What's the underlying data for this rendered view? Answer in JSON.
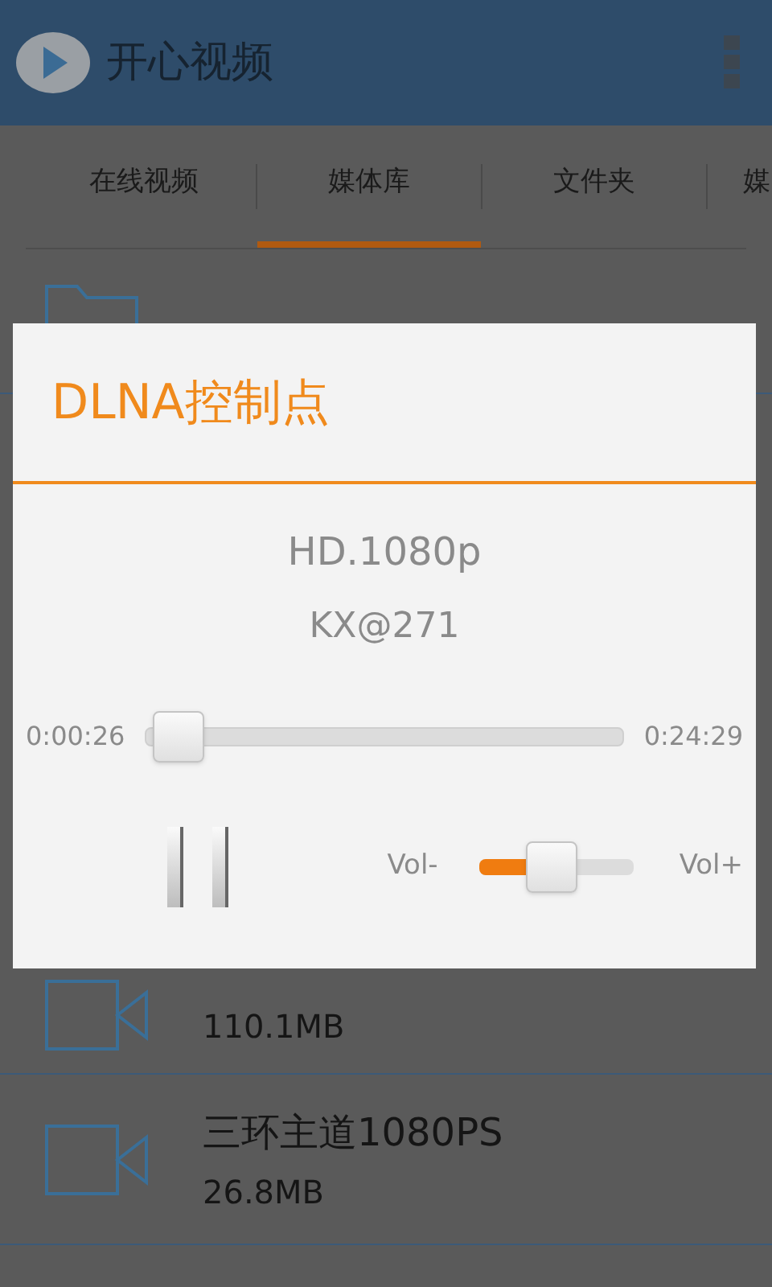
{
  "app_bar": {
    "title": "开心视频"
  },
  "tabs": [
    {
      "label": "在线视频",
      "selected": false
    },
    {
      "label": "媒体库",
      "selected": true
    },
    {
      "label": "文件夹",
      "selected": false
    },
    {
      "label": "媒",
      "selected": false
    }
  ],
  "list": [
    {
      "kind": "folder"
    },
    {
      "kind": "video",
      "size": "110.1MB"
    },
    {
      "kind": "video",
      "title": "三环主道1080PS",
      "size": "26.8MB"
    }
  ],
  "dialog": {
    "title": "DLNA控制点",
    "media_title": "HD.1080p",
    "device": "KX@271",
    "seek": {
      "elapsed": "0:00:26",
      "total": "0:24:29",
      "level": 0.02
    },
    "playing": true,
    "volume": {
      "minus_label": "Vol-",
      "plus_label": "Vol+",
      "level": 0.45
    }
  }
}
